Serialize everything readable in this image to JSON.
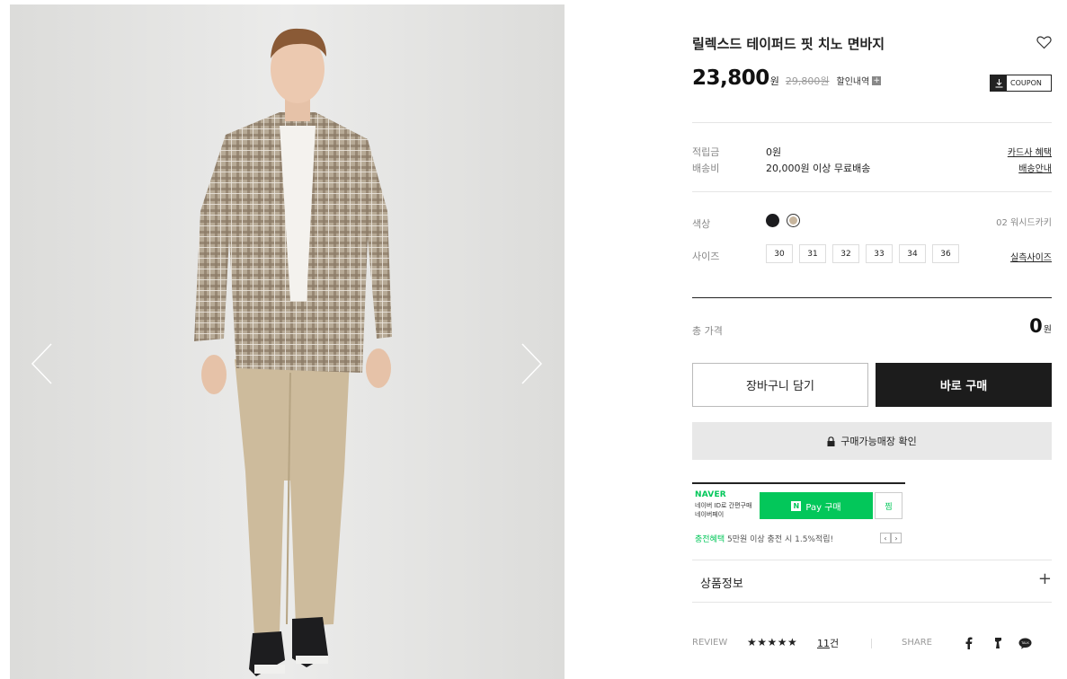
{
  "product": {
    "title": "릴렉스드 테이퍼드 핏 치노 면바지",
    "price": "23,800",
    "currency": "원",
    "original_price": "29,800원",
    "discount_link": "할인내역",
    "coupon_label": "COUPON"
  },
  "meta": {
    "points_label": "적립금",
    "points_value": "0원",
    "points_link": "카드사 혜택",
    "shipping_label": "배송비",
    "shipping_value": "20,000원 이상 무료배송",
    "shipping_link": "배송안내"
  },
  "options": {
    "color_label": "색상",
    "selected_color": "02 워시드카키",
    "colors": [
      "#1c1c1f",
      "#c7b59d"
    ],
    "size_label": "사이즈",
    "sizes": [
      "30",
      "31",
      "32",
      "33",
      "34",
      "36"
    ],
    "size_link": "실측사이즈"
  },
  "total": {
    "label": "총 가격",
    "value": "0",
    "currency": "원"
  },
  "actions": {
    "cart": "장바구니 담기",
    "buy": "바로 구매",
    "store_check": "구매가능매장 확인"
  },
  "naver_pay": {
    "logo": "NAVER",
    "desc": "네이버 ID로 간편구매 네이버페이",
    "button": "Pay 구매",
    "n_mark": "N",
    "jjim": "찜",
    "promo_highlight": "충전혜택",
    "promo_text": " 5만원 이상 충전 시 1.5%적립!",
    "prev": "‹",
    "next": "›"
  },
  "accordion": {
    "label": "상품정보",
    "toggle": "+"
  },
  "review": {
    "label": "REVIEW",
    "stars": "★★★★★",
    "count": "11",
    "count_unit": "건",
    "share_label": "SHARE"
  },
  "icons": {
    "wish": "heart-icon",
    "download": "download-icon",
    "lock": "lock-icon",
    "facebook": "facebook-icon",
    "kakaostory": "kakaostory-icon",
    "kakaotalk": "kakaotalk-icon"
  },
  "colors": {
    "accent_naver": "#03c75a",
    "buy_button": "#1c1c1c",
    "store_button": "#e8e8e8"
  }
}
